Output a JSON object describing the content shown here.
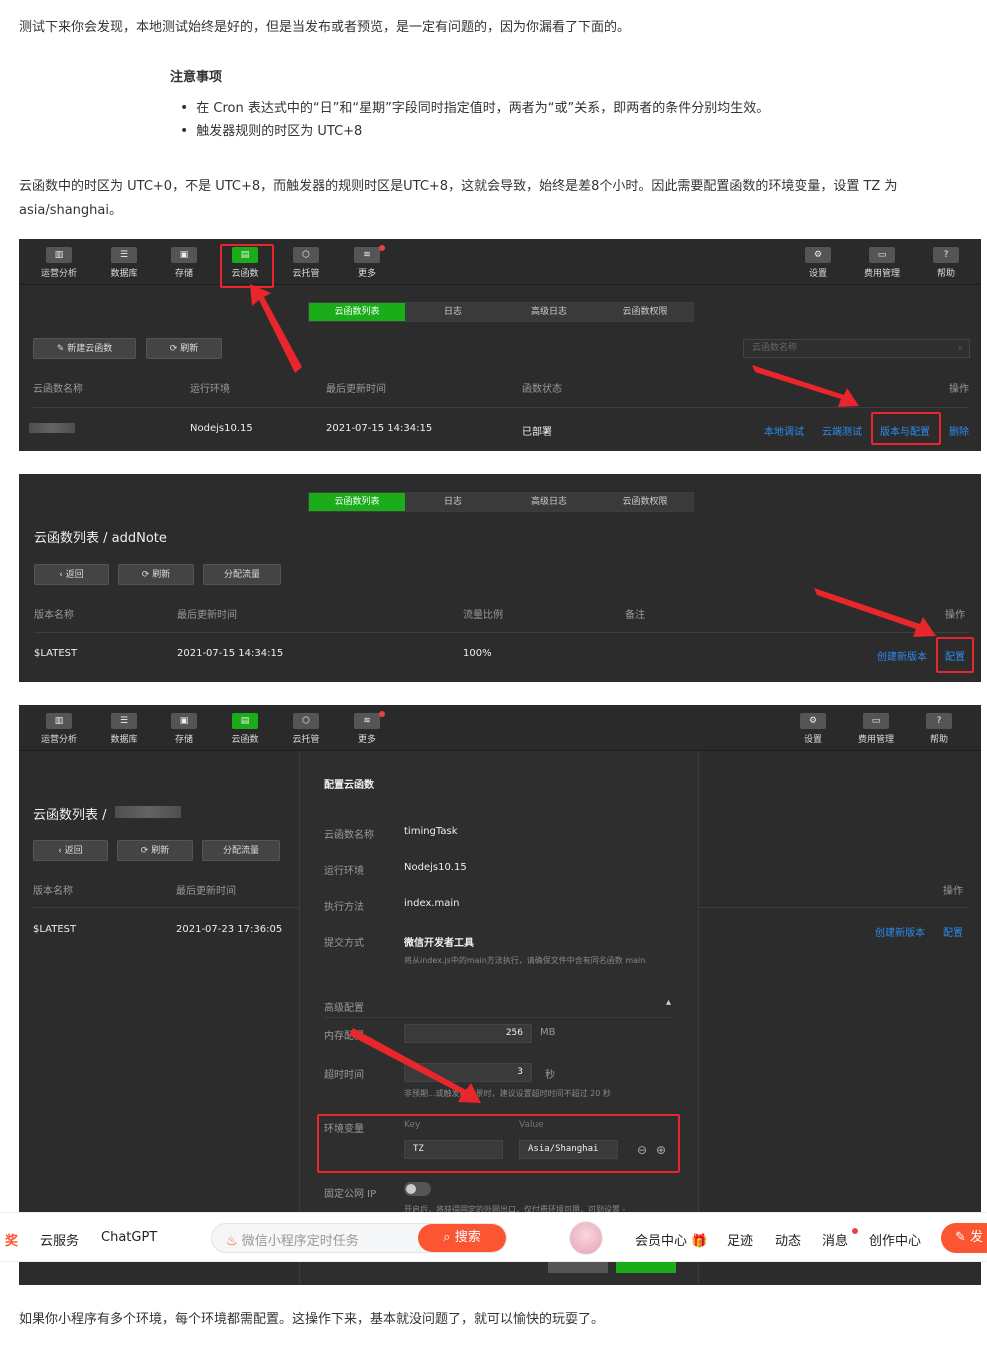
{
  "article": {
    "para1": "测试下来你会发现，本地测试始终是好的，但是当发布或者预览，是一定有问题的，因为你漏看了下面的。",
    "note_title": "注意事项",
    "notes": [
      "在 Cron 表达式中的“日”和“星期”字段同时指定值时，两者为“或”关系，即两者的条件分别均生效。",
      "触发器规则的时区为 UTC+8"
    ],
    "para2": "云函数中的时区为 UTC+0，不是 UTC+8，而触发器的规则时区是UTC+8，这就会导致，始终是差8个小时。因此需要配置函数的环境变量，设置 TZ 为 asia/shanghai。",
    "para3": "如果你小程序有多个环境，每个环境都需配置。这操作下来，基本就没问题了，就可以愉快的玩耍了。"
  },
  "toolbar": {
    "left": [
      "运营分析",
      "数据库",
      "存储",
      "云函数",
      "云托管",
      "更多"
    ],
    "right": [
      "设置",
      "费用管理",
      "帮助"
    ]
  },
  "tabs": [
    "云函数列表",
    "日志",
    "高级日志",
    "云函数权限"
  ],
  "shot1": {
    "new_btn": "新建云函数",
    "refresh_btn": "刷新",
    "search_placeholder": "云函数名称",
    "headers": [
      "云函数名称",
      "运行环境",
      "最后更新时间",
      "函数状态",
      "操作"
    ],
    "row": {
      "runtime": "Nodejs10.15",
      "updated": "2021-07-15 14:34:15",
      "status": "已部署"
    },
    "actions": [
      "本地调试",
      "云端测试",
      "版本与配置",
      "删除"
    ]
  },
  "shot2": {
    "title": "云函数列表 / addNote",
    "buttons": [
      "返回",
      "刷新",
      "分配流量"
    ],
    "headers": [
      "版本名称",
      "最后更新时间",
      "流量比例",
      "备注",
      "操作"
    ],
    "row": {
      "name": "$LATEST",
      "updated": "2021-07-15 14:34:15",
      "ratio": "100%"
    },
    "actions": [
      "创建新版本",
      "配置"
    ]
  },
  "shot3": {
    "title": "云函数列表 /",
    "buttons": [
      "返回",
      "刷新",
      "分配流量"
    ],
    "headers": [
      "版本名称",
      "最后更新时间",
      "操作"
    ],
    "row": {
      "name": "$LATEST",
      "updated": "2021-07-23 17:36:05"
    },
    "actions": [
      "创建新版本",
      "配置"
    ],
    "modal": {
      "title": "配置云函数",
      "fn_name_label": "云函数名称",
      "fn_name": "timingTask",
      "runtime_label": "运行环境",
      "runtime": "Nodejs10.15",
      "handler_label": "执行方法",
      "handler": "index.main",
      "submit_label": "提交方式",
      "submit": "微信开发者工具",
      "submit_hint": "将从index.js中的main方法执行，请确保文件中含有同名函数 main",
      "advanced": "高级配置",
      "memory_label": "内存配置",
      "memory": "256",
      "memory_unit": "MB",
      "timeout_label": "超时时间",
      "timeout": "3",
      "timeout_unit": "秒",
      "timeout_hint": "非预期...或触发器场景时，建议设置超时时间不超过 20 秒",
      "env_label": "环境变量",
      "key_label": "Key",
      "value_label": "Value",
      "env_key": "TZ",
      "env_value": "Asia/Shanghai",
      "ip_label": "固定公网 IP",
      "ip_hint": "开启后，将获得固定的外网出口，仅付费环境可用，可到设置 -"
    }
  },
  "navbar": {
    "prize": "奖",
    "items": [
      "云服务",
      "ChatGPT"
    ],
    "search_placeholder": "微信小程序定时任务",
    "search_btn": "搜索",
    "right": [
      "会员中心",
      "足迹",
      "动态",
      "消息",
      "创作中心"
    ],
    "publish": "发"
  }
}
